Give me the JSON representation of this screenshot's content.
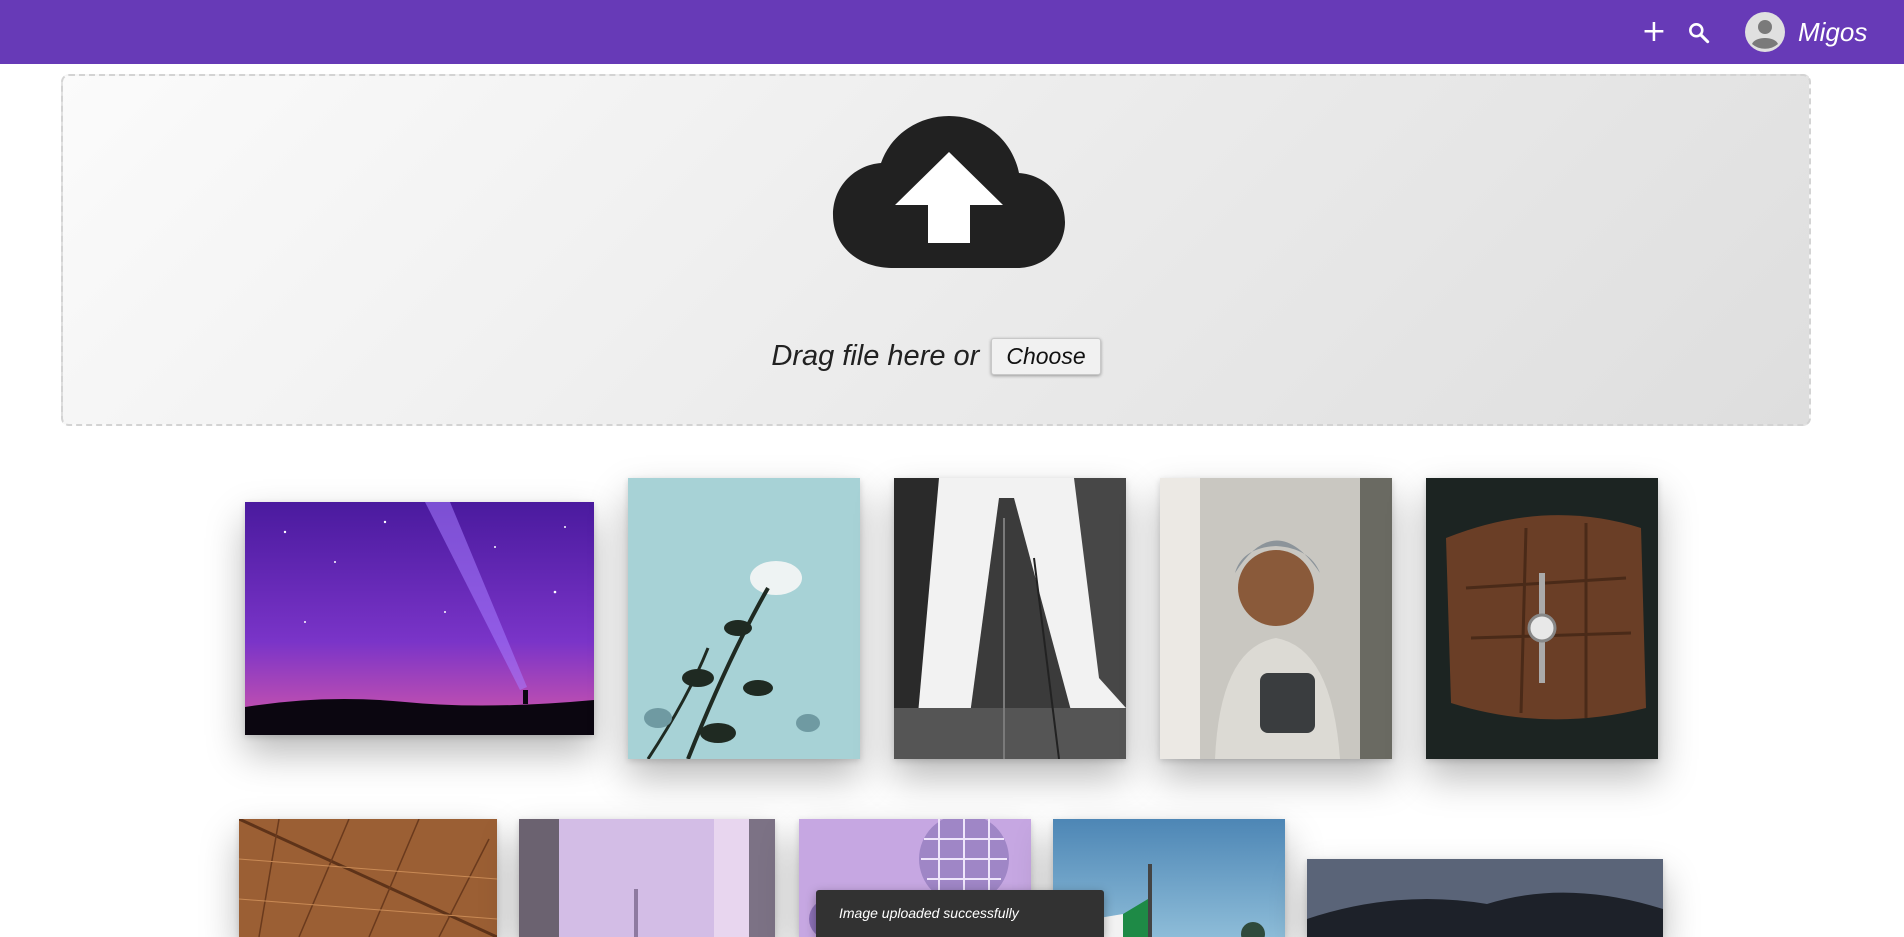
{
  "header": {
    "username": "Migos",
    "icons": [
      "plus-icon",
      "search-icon",
      "account-circle-icon"
    ]
  },
  "upload": {
    "icon": "cloud-upload-icon",
    "prompt": "Drag file here or",
    "choose_label": "Choose"
  },
  "gallery": {
    "row1": [
      "night-sky-photo",
      "white-rose-photo",
      "skyscraper-photo",
      "smiling-boy-photo",
      "wristwatch-photo"
    ],
    "row2": [
      "leaf-macro-photo",
      "window-city-photo",
      "disco-ball-photo",
      "flag-photo",
      "mountain-photo"
    ]
  },
  "snackbar": {
    "message": "Image uploaded successfully"
  },
  "colors": {
    "primary": "#673ab7",
    "snackbar": "#323232"
  }
}
